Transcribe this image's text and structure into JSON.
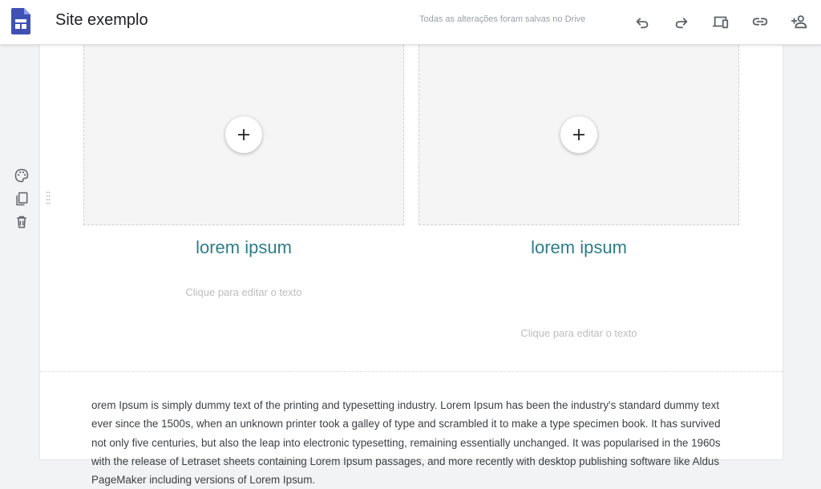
{
  "header": {
    "site_title": "Site exemplo",
    "save_status": "Todas as alterações foram salvas no Drive",
    "actions": {
      "undo": "undo-icon",
      "redo": "redo-icon",
      "preview": "devices-preview-icon",
      "link": "link-icon",
      "share": "add-person-icon"
    }
  },
  "section_tools": {
    "theme": "palette-icon",
    "duplicate": "copy-icon",
    "delete": "trash-icon"
  },
  "cards": [
    {
      "title": "lorem ipsum",
      "hint": "Clique para editar o texto"
    },
    {
      "title": "lorem ipsum",
      "hint": "Clique para editar o texto"
    }
  ],
  "body_text": "orem Ipsum is simply dummy text of the printing and typesetting industry. Lorem Ipsum has been the industry's standard dummy text ever since the 1500s, when an unknown printer took a galley of type and scrambled it to make a type specimen book. It has survived not only five centuries, but also the leap into electronic typesetting, remaining essentially unchanged. It was popularised in the 1960s with the release of Letraset sheets containing Lorem Ipsum passages, and more recently with desktop publishing software like Aldus PageMaker including versions of Lorem Ipsum.",
  "colors": {
    "accent_title": "#2d7d8a",
    "logo": "#3f51b5",
    "icon": "#5f6368"
  }
}
